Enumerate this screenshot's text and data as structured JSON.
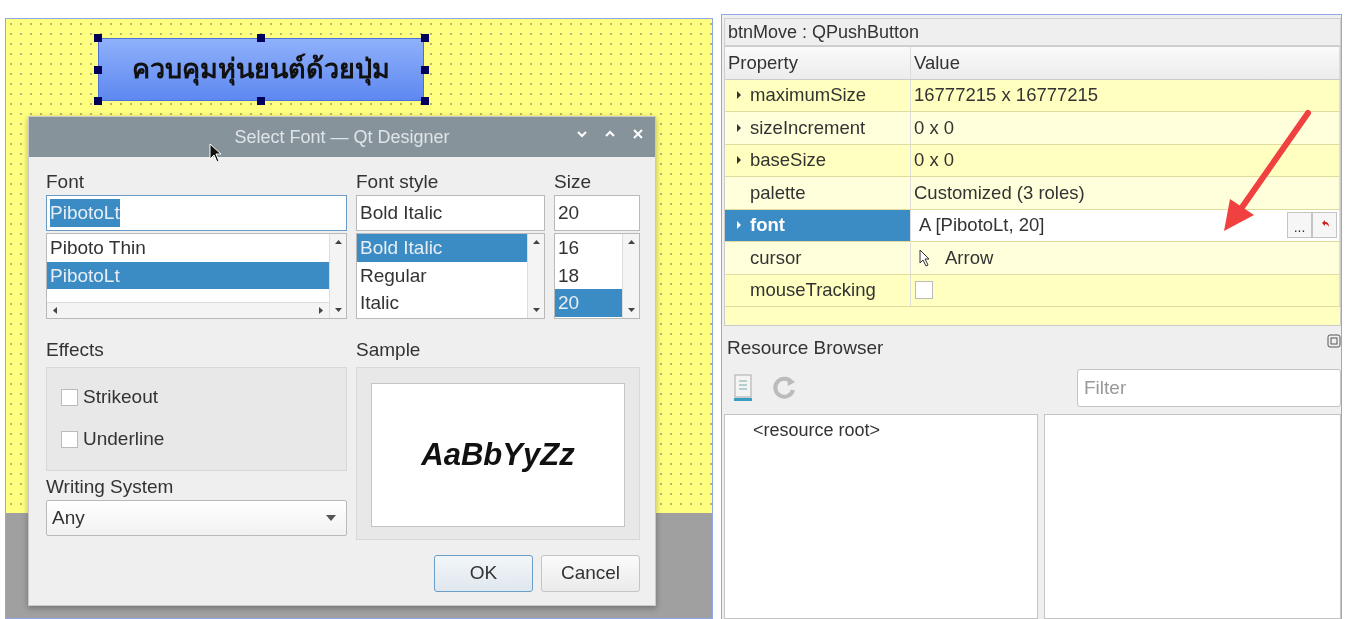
{
  "form": {
    "button": {
      "label": "ควบคุมหุ่นยนต์ด้วยปุ่ม",
      "selected": true
    }
  },
  "dialog": {
    "title": "Select Font — Qt Designer",
    "font": {
      "label": "Font",
      "value": "PibotoLt",
      "value_highlighted": true,
      "items": [
        {
          "text": "Piboto Thin",
          "selected": false
        },
        {
          "text": "PibotoLt",
          "selected": true
        }
      ]
    },
    "style": {
      "label": "Font style",
      "value": "Bold Italic",
      "items": [
        {
          "text": "Bold Italic",
          "selected": true
        },
        {
          "text": "Regular",
          "selected": false
        },
        {
          "text": "Italic",
          "selected": false
        }
      ]
    },
    "size": {
      "label": "Size",
      "value": "20",
      "items": [
        {
          "text": "16",
          "selected": false
        },
        {
          "text": "18",
          "selected": false
        },
        {
          "text": "20",
          "selected": true
        }
      ]
    },
    "effects": {
      "label": "Effects",
      "options": [
        {
          "label": "Strikeout",
          "checked": false
        },
        {
          "label": "Underline",
          "checked": false
        }
      ]
    },
    "writing_system": {
      "label": "Writing System",
      "value": "Any"
    },
    "sample": {
      "label": "Sample",
      "text": "AaBbYyZz"
    },
    "buttons": [
      {
        "label": "OK",
        "default": true
      },
      {
        "label": "Cancel",
        "default": false
      }
    ]
  },
  "property_editor": {
    "title": "btnMove : QPushButton",
    "columns": [
      "Property",
      "Value"
    ],
    "rows": [
      {
        "name": "maximumSize",
        "value": "16777215 x 16777215",
        "kind": "text",
        "expandable": true,
        "selected": false
      },
      {
        "name": "sizeIncrement",
        "value": "0 x 0",
        "kind": "text",
        "expandable": true,
        "selected": false
      },
      {
        "name": "baseSize",
        "value": "0 x 0",
        "kind": "text",
        "expandable": true,
        "selected": false
      },
      {
        "name": "palette",
        "value": "Customized (3 roles)",
        "kind": "text",
        "expandable": false,
        "selected": false
      },
      {
        "name": "font",
        "value": "A [PibotoLt, 20]",
        "button": "...",
        "kind": "font",
        "expandable": true,
        "selected": true
      },
      {
        "name": "cursor",
        "value": "Arrow",
        "kind": "cursor",
        "expandable": false,
        "selected": false
      },
      {
        "name": "mouseTracking",
        "kind": "checkbox",
        "checked": false,
        "expandable": false,
        "selected": false
      }
    ]
  },
  "resource_browser": {
    "title": "Resource Browser",
    "filter": {
      "placeholder": "Filter"
    },
    "tree": [
      {
        "label": "<resource root>"
      }
    ]
  }
}
